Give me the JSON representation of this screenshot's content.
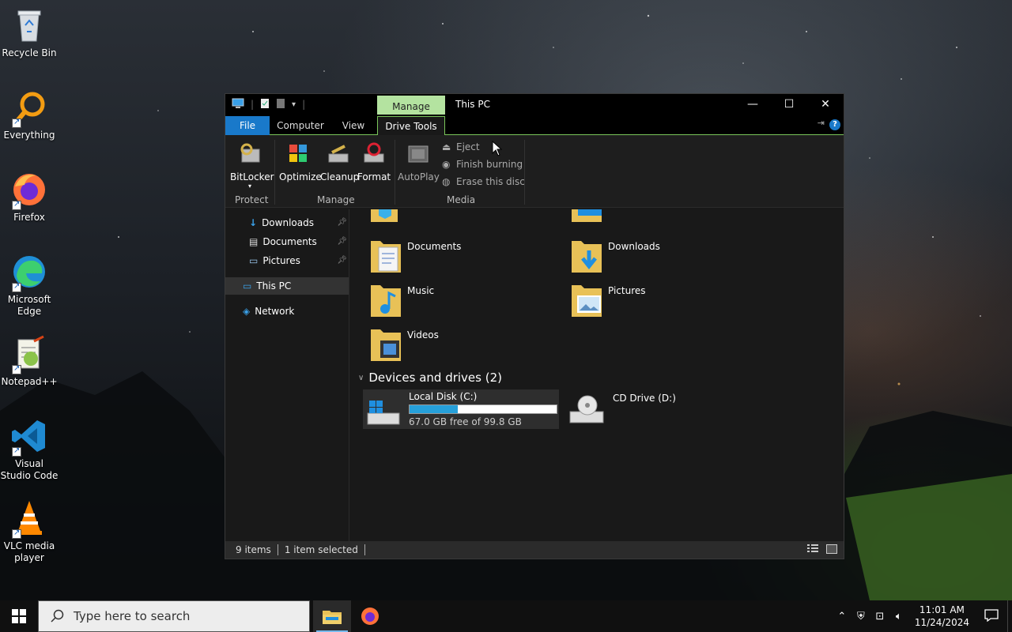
{
  "desktop": {
    "icons": [
      {
        "label": "Recycle Bin",
        "icon": "recycle-bin-icon"
      },
      {
        "label": "Everything",
        "icon": "everything-search-icon"
      },
      {
        "label": "Firefox",
        "icon": "firefox-icon"
      },
      {
        "label": "Microsoft Edge",
        "icon": "edge-icon"
      },
      {
        "label": "Notepad++",
        "icon": "notepad-plus-plus-icon"
      },
      {
        "label": "Visual Studio Code",
        "icon": "vscode-icon"
      },
      {
        "label": "VLC media player",
        "icon": "vlc-icon"
      }
    ]
  },
  "explorer": {
    "title": "This PC",
    "context_tab": "Manage",
    "tabs": [
      "File",
      "Computer",
      "View",
      "Drive Tools"
    ],
    "ribbon": {
      "bitlocker": "BitLocker",
      "optimize": "Optimize",
      "cleanup": "Cleanup",
      "format": "Format",
      "autoplay": "AutoPlay",
      "eject": "Eject",
      "finish_burning": "Finish burning",
      "erase_disc": "Erase this disc",
      "group_protect": "Protect",
      "group_manage": "Manage",
      "group_media": "Media"
    },
    "nav": {
      "downloads": "Downloads",
      "documents": "Documents",
      "pictures": "Pictures",
      "this_pc": "This PC",
      "network": "Network"
    },
    "folders": {
      "documents": "Documents",
      "downloads": "Downloads",
      "music": "Music",
      "pictures": "Pictures",
      "videos": "Videos"
    },
    "devices_header": "Devices and drives (2)",
    "drives": {
      "c_name": "Local Disk (C:)",
      "c_free": "67.0 GB free of 99.8 GB",
      "c_used_fraction": 0.33,
      "d_name": "CD Drive (D:)"
    },
    "status": {
      "items": "9 items",
      "selected": "1 item selected"
    }
  },
  "taskbar": {
    "search_placeholder": "Type here to search",
    "time": "11:01 AM",
    "date": "11/24/2024"
  },
  "colors": {
    "accent": "#1979ca",
    "context_green": "#b4e3a0",
    "drive_bar": "#26a0da"
  }
}
